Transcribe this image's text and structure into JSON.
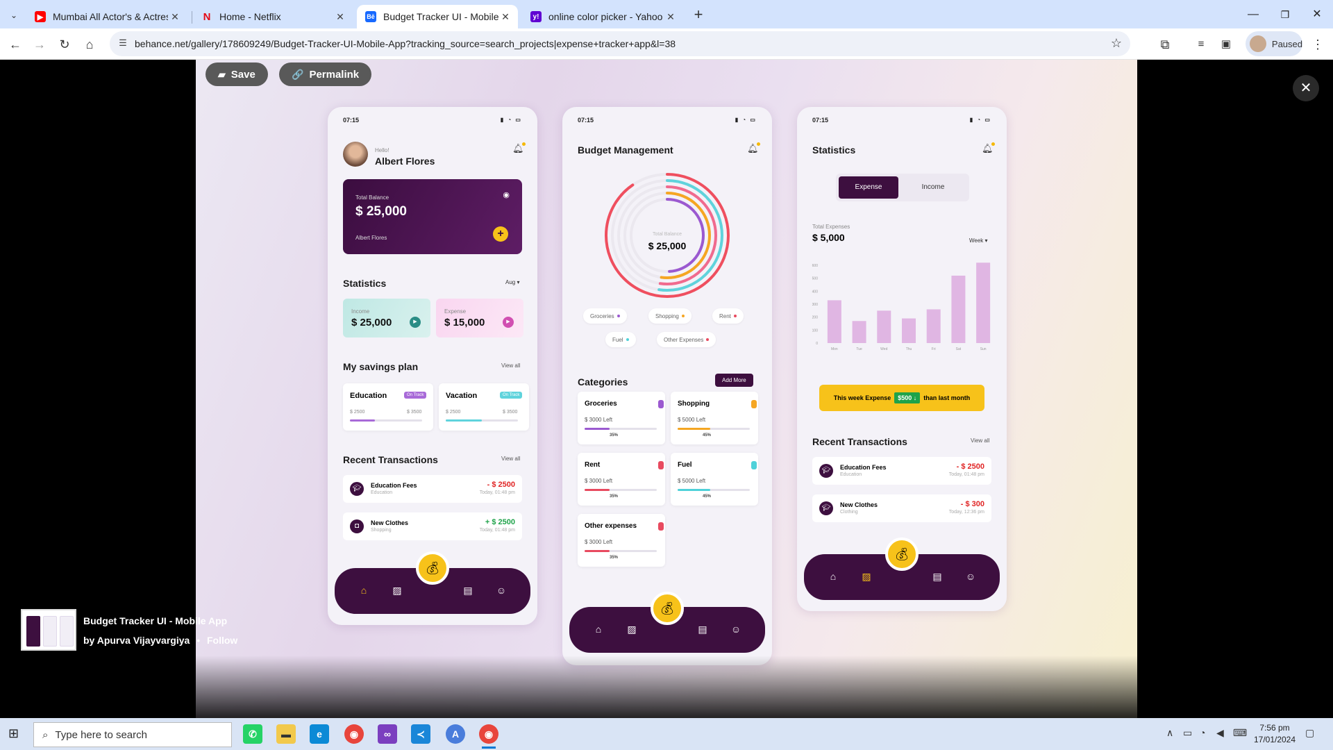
{
  "browser": {
    "tabs": [
      {
        "label": "Mumbai All Actor's & Actress h",
        "favicon": "youtube-icon",
        "color": "#ff0000"
      },
      {
        "label": "Home - Netflix",
        "favicon": "netflix-icon",
        "color": "#e50914"
      },
      {
        "label": "Budget Tracker UI - Mobile App",
        "favicon": "behance-icon",
        "color": "#1769ff"
      },
      {
        "label": "online color picker - Yahoo Sea",
        "favicon": "yahoo-icon",
        "color": "#6001d2"
      }
    ],
    "url": "behance.net/gallery/178609249/Budget-Tracker-UI-Mobile-App?tracking_source=search_projects|expense+tracker+app&l=38",
    "profile_status": "Paused"
  },
  "overlay": {
    "save_label": "Save",
    "permalink_label": "Permalink"
  },
  "phone1": {
    "time": "07:15",
    "greeting": "Hello!",
    "user": "Albert Flores",
    "balance_label": "Total Balance",
    "balance": "$ 25,000",
    "card_holder": "Albert Flores",
    "stats_title": "Statistics",
    "stats_month": "Aug",
    "income_label": "Income",
    "income_value": "$ 25,000",
    "expense_label": "Expense",
    "expense_value": "$ 15,000",
    "savings_title": "My savings plan",
    "view_all": "View all",
    "savings": [
      {
        "name": "Education",
        "badge": "On Track",
        "from": "$ 2500",
        "to": "$ 3500",
        "progress": 0.35,
        "color": "#a86ad8"
      },
      {
        "name": "Vacation",
        "badge": "On Track",
        "from": "$ 2500",
        "to": "$ 3500",
        "progress": 0.5,
        "color": "#5fd3dc"
      }
    ],
    "recent_title": "Recent Transactions",
    "transactions": [
      {
        "name": "Education Fees",
        "cat": "Education",
        "amount": "- $ 2500",
        "time": "Today, 01:48 pm",
        "color": "#e02424"
      },
      {
        "name": "New Clothes",
        "cat": "Shopping",
        "amount": "+ $ 2500",
        "time": "Today, 01:48 pm",
        "color": "#1fa34a"
      }
    ]
  },
  "phone2": {
    "time": "07:15",
    "title": "Budget Management",
    "center_label": "Total Balance",
    "center_value": "$ 25,000",
    "legend": [
      {
        "name": "Groceries",
        "color": "#9b59d0"
      },
      {
        "name": "Shopping",
        "color": "#f5a623"
      },
      {
        "name": "Rent",
        "color": "#e84a5f"
      },
      {
        "name": "Fuel",
        "color": "#4fd1d9"
      },
      {
        "name": "Other Expenses",
        "color": "#e84a5f"
      }
    ],
    "categories_title": "Categories",
    "add_more": "Add More",
    "categories": [
      {
        "name": "Groceries",
        "left": "$ 3000 Left",
        "pct": "35%",
        "progress": 0.35,
        "color": "#9b59d0"
      },
      {
        "name": "Shopping",
        "left": "$ 5000 Left",
        "pct": "45%",
        "progress": 0.45,
        "color": "#f5a623"
      },
      {
        "name": "Rent",
        "left": "$ 3000 Left",
        "pct": "35%",
        "progress": 0.35,
        "color": "#e84a5f"
      },
      {
        "name": "Fuel",
        "left": "$ 5000 Left",
        "pct": "45%",
        "progress": 0.45,
        "color": "#4fd1d9"
      },
      {
        "name": "Other expenses",
        "left": "$ 3000 Left",
        "pct": "35%",
        "progress": 0.35,
        "color": "#e84a5f"
      }
    ]
  },
  "phone3": {
    "time": "07:15",
    "title": "Statistics",
    "tab_expense": "Expense",
    "tab_income": "Income",
    "total_label": "Total Expenses",
    "total_value": "$ 5,000",
    "period": "Week",
    "banner_pre": "This week Expense",
    "banner_amount": "$500",
    "banner_post": "than last month",
    "recent_title": "Recent Transactions",
    "view_all": "View all",
    "transactions": [
      {
        "name": "Education Fees",
        "cat": "Education",
        "amount": "- $ 2500",
        "time": "Today, 01:48 pm"
      },
      {
        "name": "New Clothes",
        "cat": "Clothing",
        "amount": "- $ 300",
        "time": "Today, 12:36 pm"
      }
    ]
  },
  "chart_data": {
    "type": "bar",
    "categories": [
      "Mon",
      "Tue",
      "Wed",
      "Thu",
      "Fri",
      "Sat",
      "Sun"
    ],
    "values": [
      330,
      170,
      250,
      190,
      260,
      520,
      620
    ],
    "ylim": [
      0,
      600
    ],
    "ticks": [
      "600",
      "500",
      "400",
      "300",
      "200",
      "100",
      "0"
    ]
  },
  "project": {
    "title": "Budget Tracker UI - Mobile App",
    "by": "by Apurva Vijayvargiya",
    "follow": "Follow"
  },
  "taskbar": {
    "search_placeholder": "Type here to search",
    "time": "7:56 pm",
    "date": "17/01/2024"
  }
}
